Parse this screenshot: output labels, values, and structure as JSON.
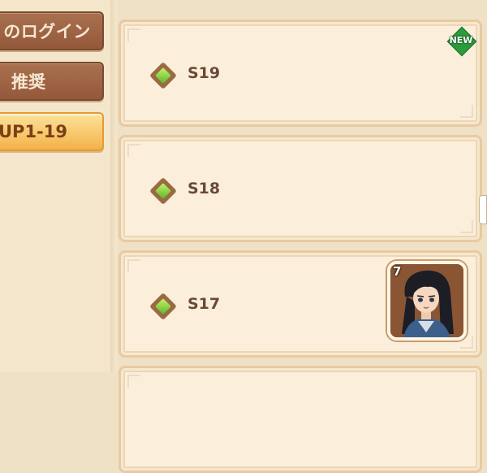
{
  "sidebar": {
    "tabs": [
      {
        "label": "のログイン",
        "state": "inactive"
      },
      {
        "label": "推奨",
        "state": "inactive"
      },
      {
        "label": "UP1-19",
        "state": "active"
      }
    ]
  },
  "seasons": [
    {
      "label": "S19",
      "badge": "NEW",
      "icon": "green-diamond-icon"
    },
    {
      "label": "S18",
      "icon": "green-diamond-icon"
    },
    {
      "label": "S17",
      "icon": "green-diamond-icon",
      "reward": {
        "count": "7",
        "icon": "character-portrait"
      }
    }
  ],
  "colors": {
    "background": "#efe1c6",
    "card": "#fbefdc",
    "tab_inactive": "#94583a",
    "tab_active": "#f3b24a",
    "text": "#6a4a35",
    "new_badge": "#2c9b3b"
  }
}
